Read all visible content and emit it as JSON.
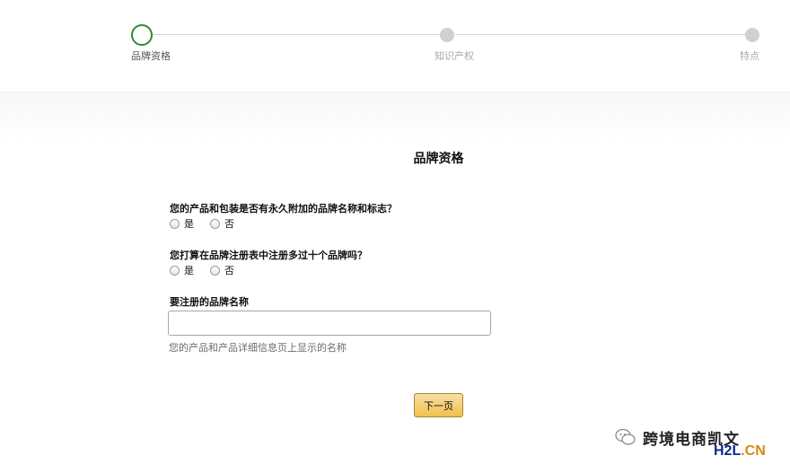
{
  "stepper": {
    "steps": [
      {
        "label": "品牌资格",
        "state": "active"
      },
      {
        "label": "知识产权",
        "state": "inactive"
      },
      {
        "label": "特点",
        "state": "inactive"
      }
    ]
  },
  "form": {
    "title": "品牌资格",
    "q1": {
      "label": "您的产品和包装是否有永久附加的品牌名称和标志？",
      "options": [
        "是",
        "否"
      ]
    },
    "q2": {
      "label": "您打算在品牌注册表中注册多过十个品牌吗？",
      "options": [
        "是",
        "否"
      ]
    },
    "brand_name": {
      "label": "要注册的品牌名称",
      "value": "",
      "hint": "您的产品和产品详细信息页上显示的名称"
    },
    "next_button": "下一页"
  },
  "watermark": {
    "text": "跨境电商凯文",
    "site_prefix": "H2L",
    "site_suffix": ".CN"
  },
  "colors": {
    "active_step": "#2e8b2e",
    "button_top": "#f7dfa5",
    "button_bottom": "#f0c14b"
  }
}
